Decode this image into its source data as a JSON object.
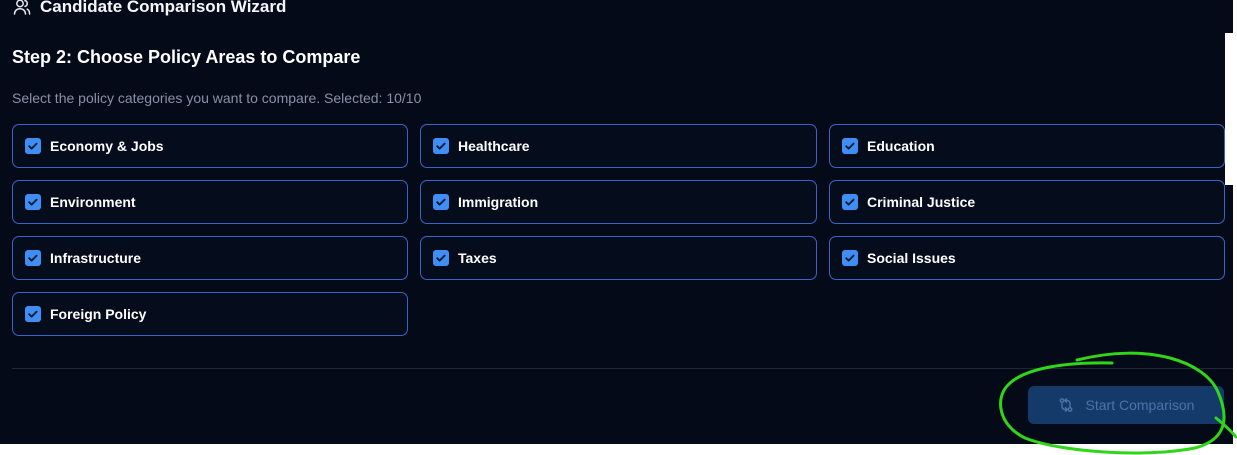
{
  "header": {
    "title": "Candidate Comparison Wizard",
    "icon": "users-icon"
  },
  "step": {
    "title": "Step 2: Choose Policy Areas to Compare",
    "subtitle": "Select the policy categories you want to compare. Selected: 10/10"
  },
  "options": [
    {
      "label": "Economy & Jobs",
      "checked": true
    },
    {
      "label": "Healthcare",
      "checked": true
    },
    {
      "label": "Education",
      "checked": true
    },
    {
      "label": "Environment",
      "checked": true
    },
    {
      "label": "Immigration",
      "checked": true
    },
    {
      "label": "Criminal Justice",
      "checked": true
    },
    {
      "label": "Infrastructure",
      "checked": true
    },
    {
      "label": "Taxes",
      "checked": true
    },
    {
      "label": "Social Issues",
      "checked": true
    },
    {
      "label": "Foreign Policy",
      "checked": true
    }
  ],
  "footer": {
    "start_label": "Start Comparison",
    "start_icon": "compare-arrows-icon"
  },
  "colors": {
    "background": "#040a18",
    "option_border": "#3c63c9",
    "checkbox": "#3f8ef5",
    "button_bg": "#143a6a",
    "annotation": "#2fd61a"
  }
}
